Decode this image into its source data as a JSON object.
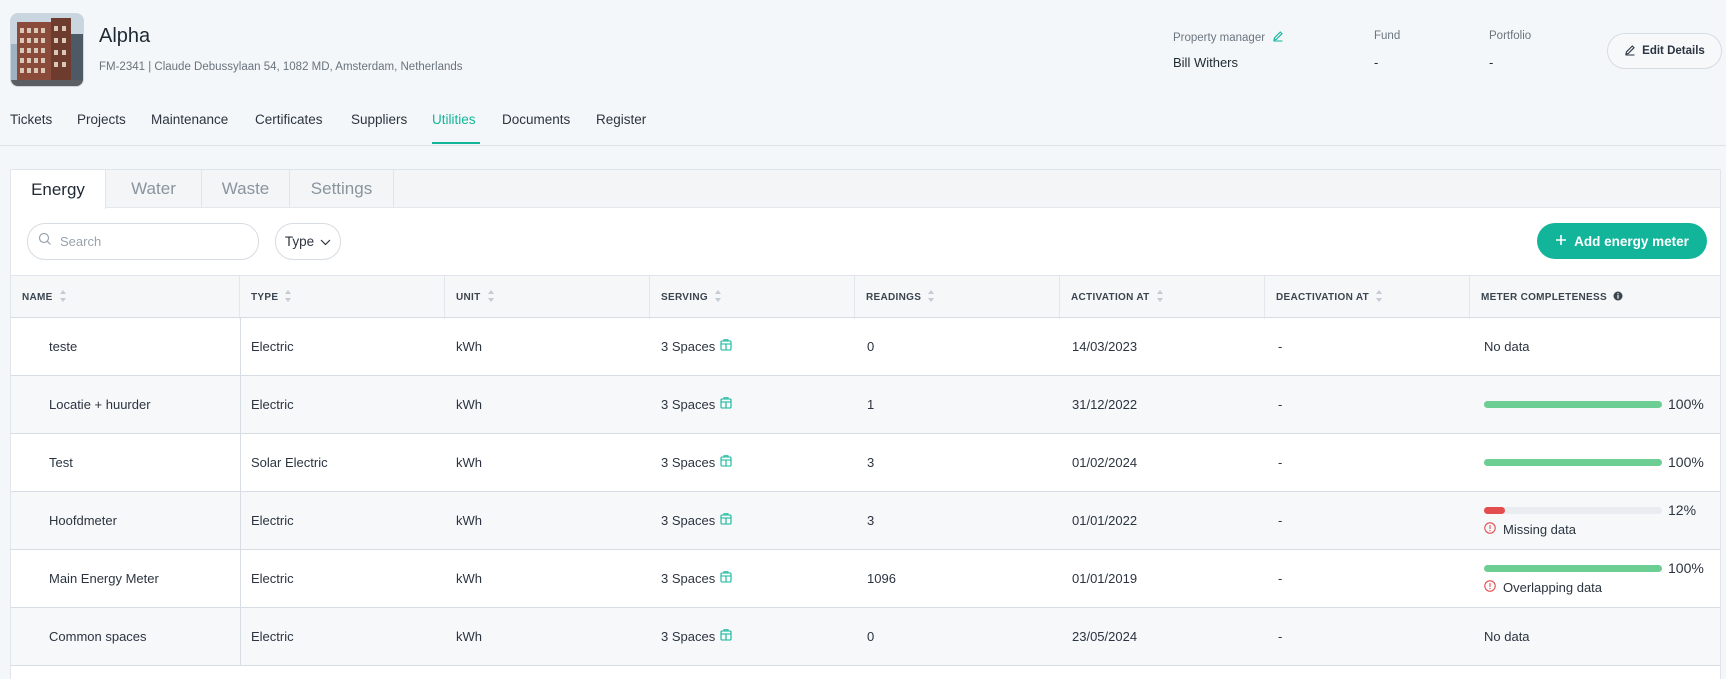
{
  "property": {
    "name": "Alpha",
    "subtitle": "FM-2341 | Claude Debussylaan 54, 1082 MD, Amsterdam, Netherlands"
  },
  "meta": {
    "property_manager_label": "Property manager",
    "property_manager_value": "Bill Withers",
    "fund_label": "Fund",
    "fund_value": "-",
    "portfolio_label": "Portfolio",
    "portfolio_value": "-"
  },
  "edit_button_label": "Edit Details",
  "nav": {
    "items": [
      "Tickets",
      "Projects",
      "Maintenance",
      "Certificates",
      "Suppliers",
      "Utilities",
      "Documents",
      "Register"
    ],
    "active": "Utilities"
  },
  "subtabs": {
    "items": [
      "Energy",
      "Water",
      "Waste",
      "Settings"
    ],
    "active": "Energy"
  },
  "toolbar": {
    "search_placeholder": "Search",
    "type_filter_label": "Type",
    "add_button_label": "Add energy meter"
  },
  "table": {
    "columns": [
      "NAME",
      "TYPE",
      "UNIT",
      "SERVING",
      "READINGS",
      "ACTIVATION AT",
      "DEACTIVATION AT",
      "METER COMPLETENESS"
    ],
    "rows": [
      {
        "name": "teste",
        "type": "Electric",
        "unit": "kWh",
        "serving": "3 Spaces",
        "readings": "0",
        "activation": "14/03/2023",
        "deactivation": "-",
        "completeness": {
          "status": "No data"
        }
      },
      {
        "name": "Locatie + huurder",
        "type": "Electric",
        "unit": "kWh",
        "serving": "3 Spaces",
        "readings": "1",
        "activation": "31/12/2022",
        "deactivation": "-",
        "completeness": {
          "percent": 100,
          "label": "100%",
          "color": "#6cce93"
        }
      },
      {
        "name": "Test",
        "type": "Solar Electric",
        "unit": "kWh",
        "serving": "3 Spaces",
        "readings": "3",
        "activation": "01/02/2024",
        "deactivation": "-",
        "completeness": {
          "percent": 100,
          "label": "100%",
          "color": "#6cce93"
        }
      },
      {
        "name": "Hoofdmeter",
        "type": "Electric",
        "unit": "kWh",
        "serving": "3 Spaces",
        "readings": "3",
        "activation": "01/01/2022",
        "deactivation": "-",
        "completeness": {
          "percent": 12,
          "label": "12%",
          "color": "#e34d4d",
          "warning": "Missing data"
        }
      },
      {
        "name": "Main Energy Meter",
        "type": "Electric",
        "unit": "kWh",
        "serving": "3 Spaces",
        "readings": "1096",
        "activation": "01/01/2019",
        "deactivation": "-",
        "completeness": {
          "percent": 100,
          "label": "100%",
          "color": "#6cce93",
          "warning": "Overlapping data"
        }
      },
      {
        "name": "Common spaces",
        "type": "Electric",
        "unit": "kWh",
        "serving": "3 Spaces",
        "readings": "0",
        "activation": "23/05/2024",
        "deactivation": "-",
        "completeness": {
          "status": "No data"
        }
      }
    ]
  },
  "colors": {
    "accent": "#12b59a",
    "progress_ok": "#6cce93",
    "progress_bad": "#e34d4d",
    "warning": "#e34d4d"
  }
}
